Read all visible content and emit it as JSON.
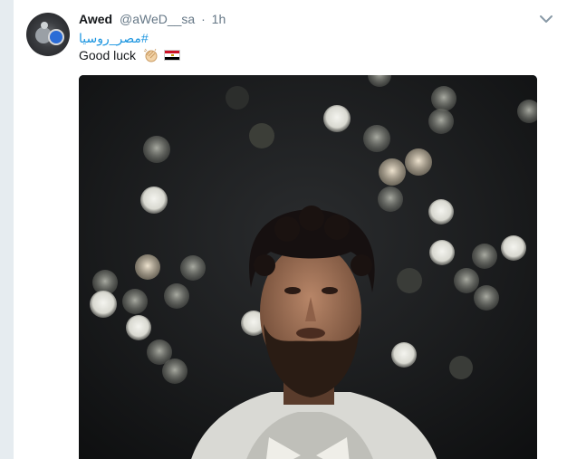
{
  "tweet": {
    "author_name": "Awed",
    "author_handle": "@aWeD__sa",
    "separator": "·",
    "timestamp": "1h",
    "hashtag": "#مصر_روسيا",
    "text": "Good luck",
    "emojis": [
      "clapping-hands-icon",
      "egypt-flag-icon"
    ],
    "menu_icon": "chevron-down-icon"
  },
  "colors": {
    "link": "#1b95e0",
    "name": "#14171a",
    "meta": "#657786",
    "background": "#e6ecf0"
  }
}
